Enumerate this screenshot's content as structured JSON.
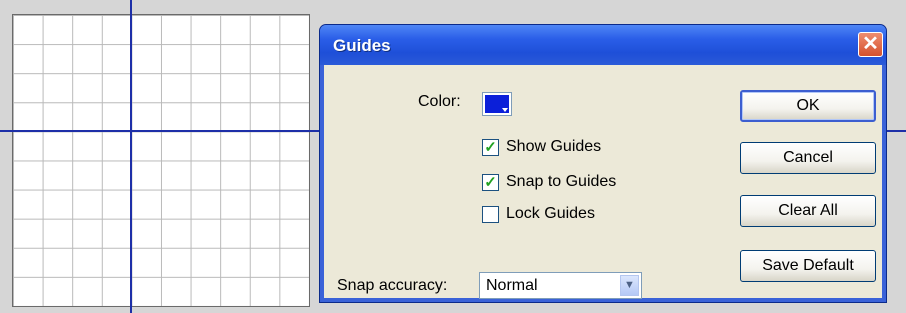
{
  "dialog": {
    "title": "Guides",
    "close_symbol": "✕",
    "color_label": "Color:",
    "color_value": "#0b1fd9",
    "checkboxes": [
      {
        "label": "Show Guides",
        "checked": true
      },
      {
        "label": "Snap to Guides",
        "checked": true
      },
      {
        "label": "Lock Guides",
        "checked": false
      }
    ],
    "checkmark": "✓",
    "snap_accuracy_label": "Snap accuracy:",
    "snap_accuracy_value": "Normal",
    "dropdown_symbol": "▼",
    "buttons": {
      "ok": "OK",
      "cancel": "Cancel",
      "clear_all": "Clear All",
      "save_default": "Save Default"
    }
  },
  "stage": {
    "guide_color": "#1d2fa8",
    "grid_color": "#b9b9b9"
  }
}
